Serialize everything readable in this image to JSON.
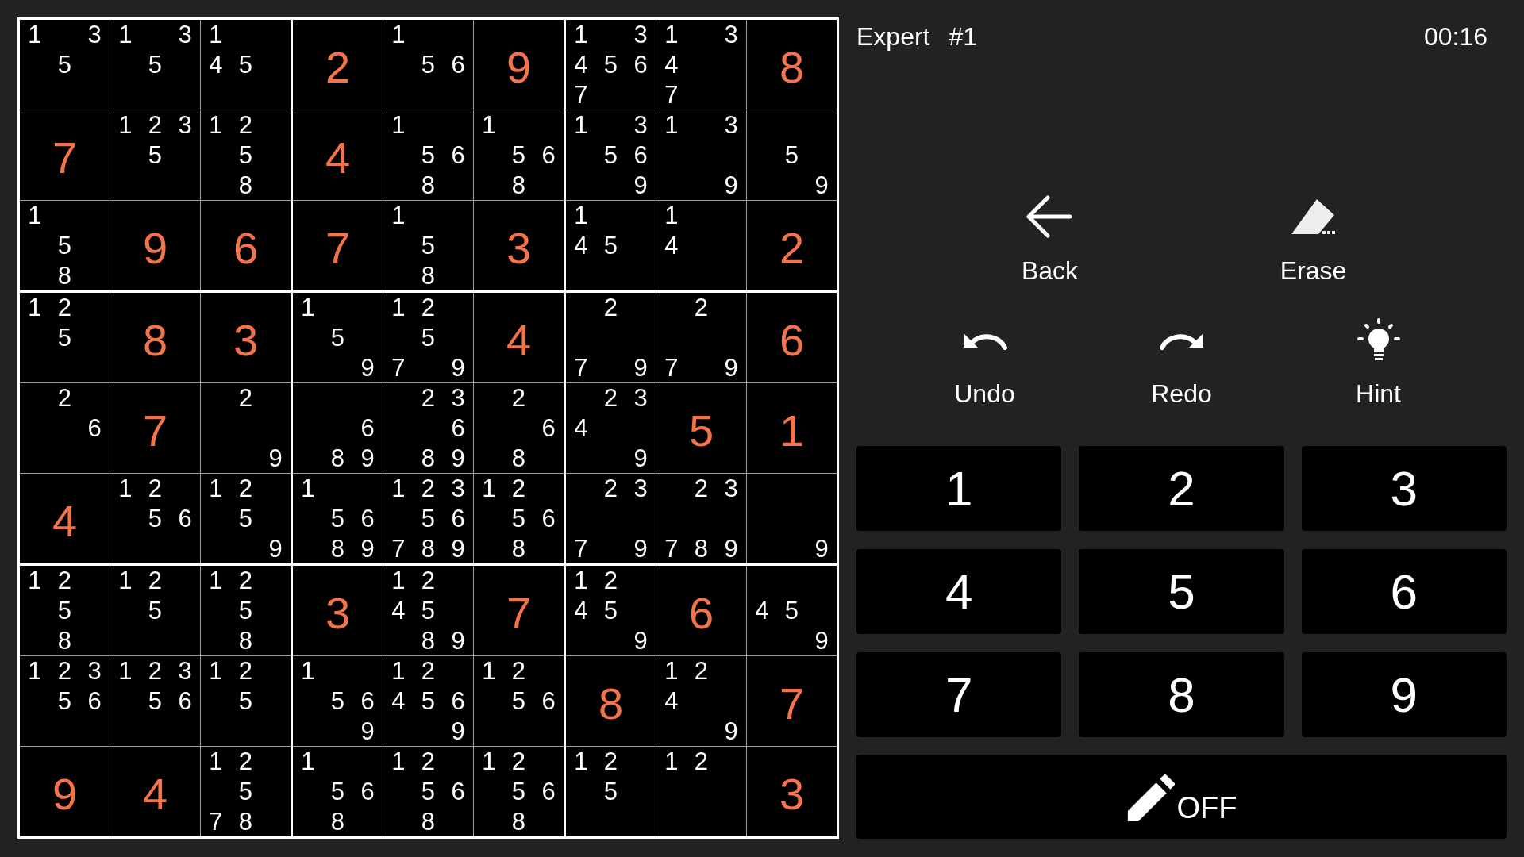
{
  "header": {
    "difficulty": "Expert",
    "puzzle_number": "#1",
    "timer": "00:16"
  },
  "grid": {
    "rows": [
      [
        {
          "kind": "notes",
          "notes": [
            "1",
            "3",
            "5"
          ]
        },
        {
          "kind": "notes",
          "notes": [
            "1",
            "3",
            "5"
          ]
        },
        {
          "kind": "notes",
          "notes": [
            "1",
            "4",
            "5"
          ]
        },
        {
          "kind": "given",
          "value": "2"
        },
        {
          "kind": "notes",
          "notes": [
            "1",
            "5",
            "6"
          ]
        },
        {
          "kind": "given",
          "value": "9"
        },
        {
          "kind": "notes",
          "notes": [
            "1",
            "3",
            "4",
            "5",
            "6",
            "7"
          ]
        },
        {
          "kind": "notes",
          "notes": [
            "1",
            "3",
            "4",
            "7"
          ]
        },
        {
          "kind": "given",
          "value": "8"
        }
      ],
      [
        {
          "kind": "given",
          "value": "7"
        },
        {
          "kind": "notes",
          "notes": [
            "1",
            "2",
            "3",
            "5"
          ]
        },
        {
          "kind": "notes",
          "notes": [
            "1",
            "2",
            "5",
            "8"
          ]
        },
        {
          "kind": "given",
          "value": "4"
        },
        {
          "kind": "notes",
          "notes": [
            "1",
            "5",
            "6",
            "8"
          ]
        },
        {
          "kind": "notes",
          "notes": [
            "1",
            "5",
            "6",
            "8"
          ]
        },
        {
          "kind": "notes",
          "notes": [
            "1",
            "3",
            "5",
            "6",
            "9"
          ]
        },
        {
          "kind": "notes",
          "notes": [
            "1",
            "3",
            "9"
          ]
        },
        {
          "kind": "notes",
          "notes": [
            "5",
            "9"
          ]
        }
      ],
      [
        {
          "kind": "notes",
          "notes": [
            "1",
            "5",
            "8"
          ]
        },
        {
          "kind": "given",
          "value": "9"
        },
        {
          "kind": "given",
          "value": "6"
        },
        {
          "kind": "given",
          "value": "7"
        },
        {
          "kind": "notes",
          "notes": [
            "1",
            "5",
            "8"
          ]
        },
        {
          "kind": "given",
          "value": "3"
        },
        {
          "kind": "notes",
          "notes": [
            "1",
            "4",
            "5"
          ]
        },
        {
          "kind": "notes",
          "notes": [
            "1",
            "4"
          ]
        },
        {
          "kind": "given",
          "value": "2"
        }
      ],
      [
        {
          "kind": "notes",
          "notes": [
            "1",
            "2",
            "5"
          ]
        },
        {
          "kind": "given",
          "value": "8"
        },
        {
          "kind": "given",
          "value": "3"
        },
        {
          "kind": "notes",
          "notes": [
            "1",
            "5",
            "9"
          ]
        },
        {
          "kind": "notes",
          "notes": [
            "1",
            "2",
            "5",
            "7",
            "9"
          ]
        },
        {
          "kind": "given",
          "value": "4"
        },
        {
          "kind": "notes",
          "notes": [
            "2",
            "7",
            "9"
          ]
        },
        {
          "kind": "notes",
          "notes": [
            "2",
            "7",
            "9"
          ]
        },
        {
          "kind": "given",
          "value": "6"
        }
      ],
      [
        {
          "kind": "notes",
          "notes": [
            "2",
            "6"
          ]
        },
        {
          "kind": "given",
          "value": "7"
        },
        {
          "kind": "notes",
          "notes": [
            "2",
            "9"
          ]
        },
        {
          "kind": "notes",
          "notes": [
            "6",
            "8",
            "9"
          ]
        },
        {
          "kind": "notes",
          "notes": [
            "2",
            "3",
            "6",
            "8",
            "9"
          ]
        },
        {
          "kind": "notes",
          "notes": [
            "2",
            "6",
            "8"
          ]
        },
        {
          "kind": "notes",
          "notes": [
            "2",
            "3",
            "4",
            "9"
          ]
        },
        {
          "kind": "given",
          "value": "5"
        },
        {
          "kind": "given",
          "value": "1"
        }
      ],
      [
        {
          "kind": "given",
          "value": "4"
        },
        {
          "kind": "notes",
          "notes": [
            "1",
            "2",
            "5",
            "6"
          ]
        },
        {
          "kind": "notes",
          "notes": [
            "1",
            "2",
            "5",
            "9"
          ]
        },
        {
          "kind": "notes",
          "notes": [
            "1",
            "5",
            "6",
            "8",
            "9"
          ]
        },
        {
          "kind": "notes",
          "notes": [
            "1",
            "2",
            "3",
            "5",
            "6",
            "7",
            "8",
            "9"
          ]
        },
        {
          "kind": "notes",
          "notes": [
            "1",
            "2",
            "5",
            "6",
            "8"
          ]
        },
        {
          "kind": "notes",
          "notes": [
            "2",
            "3",
            "7",
            "9"
          ]
        },
        {
          "kind": "notes",
          "notes": [
            "2",
            "3",
            "7",
            "8",
            "9"
          ]
        },
        {
          "kind": "notes",
          "notes": [
            "9"
          ]
        }
      ],
      [
        {
          "kind": "notes",
          "notes": [
            "1",
            "2",
            "5",
            "8"
          ]
        },
        {
          "kind": "notes",
          "notes": [
            "1",
            "2",
            "5"
          ]
        },
        {
          "kind": "notes",
          "notes": [
            "1",
            "2",
            "5",
            "8"
          ]
        },
        {
          "kind": "given",
          "value": "3"
        },
        {
          "kind": "notes",
          "notes": [
            "1",
            "2",
            "4",
            "5",
            "8",
            "9"
          ]
        },
        {
          "kind": "given",
          "value": "7"
        },
        {
          "kind": "notes",
          "notes": [
            "1",
            "2",
            "4",
            "5",
            "9"
          ]
        },
        {
          "kind": "given",
          "value": "6"
        },
        {
          "kind": "notes",
          "notes": [
            "4",
            "5",
            "9"
          ]
        }
      ],
      [
        {
          "kind": "notes",
          "notes": [
            "1",
            "2",
            "3",
            "5",
            "6"
          ]
        },
        {
          "kind": "notes",
          "notes": [
            "1",
            "2",
            "3",
            "5",
            "6"
          ]
        },
        {
          "kind": "notes",
          "notes": [
            "1",
            "2",
            "5"
          ]
        },
        {
          "kind": "notes",
          "notes": [
            "1",
            "5",
            "6",
            "9"
          ]
        },
        {
          "kind": "notes",
          "notes": [
            "1",
            "2",
            "4",
            "5",
            "6",
            "9"
          ]
        },
        {
          "kind": "notes",
          "notes": [
            "1",
            "2",
            "5",
            "6"
          ]
        },
        {
          "kind": "given",
          "value": "8"
        },
        {
          "kind": "notes",
          "notes": [
            "1",
            "2",
            "4",
            "9"
          ]
        },
        {
          "kind": "given",
          "value": "7"
        }
      ],
      [
        {
          "kind": "given",
          "value": "9"
        },
        {
          "kind": "given",
          "value": "4"
        },
        {
          "kind": "notes",
          "notes": [
            "1",
            "2",
            "5",
            "7",
            "8"
          ]
        },
        {
          "kind": "notes",
          "notes": [
            "1",
            "5",
            "6",
            "8"
          ]
        },
        {
          "kind": "notes",
          "notes": [
            "1",
            "2",
            "5",
            "6",
            "8"
          ]
        },
        {
          "kind": "notes",
          "notes": [
            "1",
            "2",
            "5",
            "6",
            "8"
          ]
        },
        {
          "kind": "notes",
          "notes": [
            "1",
            "2",
            "5"
          ]
        },
        {
          "kind": "notes",
          "notes": [
            "1",
            "2"
          ]
        },
        {
          "kind": "given",
          "value": "3"
        }
      ]
    ]
  },
  "actions": [
    [
      {
        "kind": "back",
        "label": "Back"
      },
      {
        "kind": "erase",
        "label": "Erase"
      }
    ],
    [
      {
        "kind": "undo",
        "label": "Undo"
      },
      {
        "kind": "redo",
        "label": "Redo"
      },
      {
        "kind": "hint",
        "label": "Hint"
      }
    ]
  ],
  "number_pad": [
    "1",
    "2",
    "3",
    "4",
    "5",
    "6",
    "7",
    "8",
    "9"
  ],
  "pencil_button": {
    "label": "OFF"
  }
}
